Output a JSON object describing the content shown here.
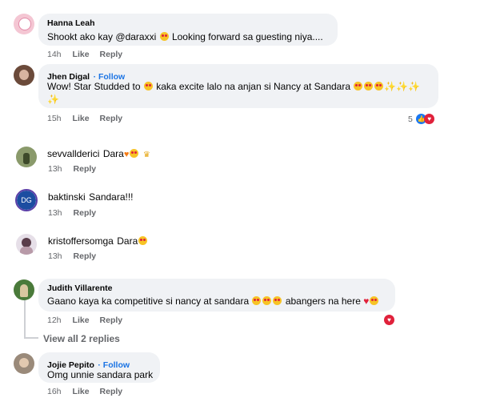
{
  "comments": [
    {
      "name": "Hanna Leah",
      "text": "Shookt ako kay @daraxxi",
      "text2": "Looking forward sa guesting niya....",
      "time": "14h",
      "like": "Like",
      "reply": "Reply"
    },
    {
      "name": "Jhen Digal",
      "follow": "· Follow",
      "text": "Wow! Star Studded to",
      "text2": "kaka excite lalo na anjan si Nancy at Sandara",
      "time": "15h",
      "like": "Like",
      "reply": "Reply",
      "reaction_count": "5"
    },
    {
      "name": "sevvallderici",
      "text": "Dara",
      "time": "13h",
      "reply": "Reply"
    },
    {
      "name": "baktinski",
      "text": "Sandara!!!",
      "time": "13h",
      "reply": "Reply",
      "avatar_initials": "DG"
    },
    {
      "name": "kristoffersomga",
      "text": "Dara",
      "time": "13h",
      "reply": "Reply"
    },
    {
      "name": "Judith Villarente",
      "text": "Gaano kaya ka competitive si nancy at sandara",
      "text2": "abangers na here",
      "time": "12h",
      "like": "Like",
      "reply": "Reply"
    },
    {
      "name": "Jojie Pepito",
      "follow": "· Follow",
      "text": "Omg unnie sandara park",
      "time": "16h",
      "like": "Like",
      "reply": "Reply"
    }
  ],
  "view_replies": "View all 2 replies",
  "colors": {
    "bubble": "#f0f2f5",
    "meta": "#65676b",
    "follow": "#1b74e4",
    "like_blue": "#1877f2",
    "love_red": "#e0213b"
  }
}
